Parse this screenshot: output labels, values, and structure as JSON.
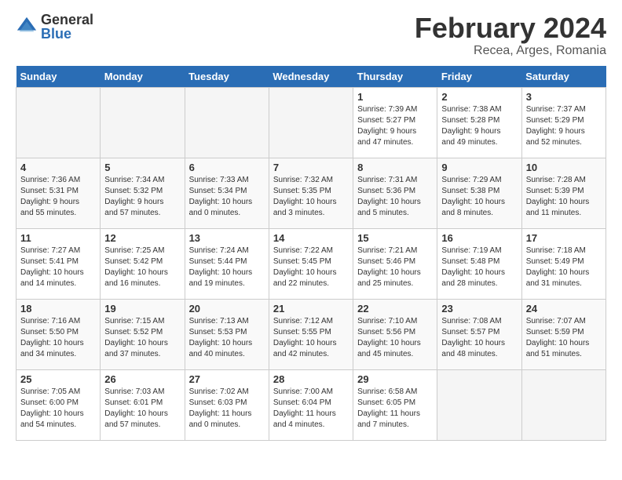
{
  "header": {
    "logo_general": "General",
    "logo_blue": "Blue",
    "month_title": "February 2024",
    "location": "Recea, Arges, Romania"
  },
  "days_of_week": [
    "Sunday",
    "Monday",
    "Tuesday",
    "Wednesday",
    "Thursday",
    "Friday",
    "Saturday"
  ],
  "weeks": [
    [
      {
        "day": "",
        "info": ""
      },
      {
        "day": "",
        "info": ""
      },
      {
        "day": "",
        "info": ""
      },
      {
        "day": "",
        "info": ""
      },
      {
        "day": "1",
        "info": "Sunrise: 7:39 AM\nSunset: 5:27 PM\nDaylight: 9 hours\nand 47 minutes."
      },
      {
        "day": "2",
        "info": "Sunrise: 7:38 AM\nSunset: 5:28 PM\nDaylight: 9 hours\nand 49 minutes."
      },
      {
        "day": "3",
        "info": "Sunrise: 7:37 AM\nSunset: 5:29 PM\nDaylight: 9 hours\nand 52 minutes."
      }
    ],
    [
      {
        "day": "4",
        "info": "Sunrise: 7:36 AM\nSunset: 5:31 PM\nDaylight: 9 hours\nand 55 minutes."
      },
      {
        "day": "5",
        "info": "Sunrise: 7:34 AM\nSunset: 5:32 PM\nDaylight: 9 hours\nand 57 minutes."
      },
      {
        "day": "6",
        "info": "Sunrise: 7:33 AM\nSunset: 5:34 PM\nDaylight: 10 hours\nand 0 minutes."
      },
      {
        "day": "7",
        "info": "Sunrise: 7:32 AM\nSunset: 5:35 PM\nDaylight: 10 hours\nand 3 minutes."
      },
      {
        "day": "8",
        "info": "Sunrise: 7:31 AM\nSunset: 5:36 PM\nDaylight: 10 hours\nand 5 minutes."
      },
      {
        "day": "9",
        "info": "Sunrise: 7:29 AM\nSunset: 5:38 PM\nDaylight: 10 hours\nand 8 minutes."
      },
      {
        "day": "10",
        "info": "Sunrise: 7:28 AM\nSunset: 5:39 PM\nDaylight: 10 hours\nand 11 minutes."
      }
    ],
    [
      {
        "day": "11",
        "info": "Sunrise: 7:27 AM\nSunset: 5:41 PM\nDaylight: 10 hours\nand 14 minutes."
      },
      {
        "day": "12",
        "info": "Sunrise: 7:25 AM\nSunset: 5:42 PM\nDaylight: 10 hours\nand 16 minutes."
      },
      {
        "day": "13",
        "info": "Sunrise: 7:24 AM\nSunset: 5:44 PM\nDaylight: 10 hours\nand 19 minutes."
      },
      {
        "day": "14",
        "info": "Sunrise: 7:22 AM\nSunset: 5:45 PM\nDaylight: 10 hours\nand 22 minutes."
      },
      {
        "day": "15",
        "info": "Sunrise: 7:21 AM\nSunset: 5:46 PM\nDaylight: 10 hours\nand 25 minutes."
      },
      {
        "day": "16",
        "info": "Sunrise: 7:19 AM\nSunset: 5:48 PM\nDaylight: 10 hours\nand 28 minutes."
      },
      {
        "day": "17",
        "info": "Sunrise: 7:18 AM\nSunset: 5:49 PM\nDaylight: 10 hours\nand 31 minutes."
      }
    ],
    [
      {
        "day": "18",
        "info": "Sunrise: 7:16 AM\nSunset: 5:50 PM\nDaylight: 10 hours\nand 34 minutes."
      },
      {
        "day": "19",
        "info": "Sunrise: 7:15 AM\nSunset: 5:52 PM\nDaylight: 10 hours\nand 37 minutes."
      },
      {
        "day": "20",
        "info": "Sunrise: 7:13 AM\nSunset: 5:53 PM\nDaylight: 10 hours\nand 40 minutes."
      },
      {
        "day": "21",
        "info": "Sunrise: 7:12 AM\nSunset: 5:55 PM\nDaylight: 10 hours\nand 42 minutes."
      },
      {
        "day": "22",
        "info": "Sunrise: 7:10 AM\nSunset: 5:56 PM\nDaylight: 10 hours\nand 45 minutes."
      },
      {
        "day": "23",
        "info": "Sunrise: 7:08 AM\nSunset: 5:57 PM\nDaylight: 10 hours\nand 48 minutes."
      },
      {
        "day": "24",
        "info": "Sunrise: 7:07 AM\nSunset: 5:59 PM\nDaylight: 10 hours\nand 51 minutes."
      }
    ],
    [
      {
        "day": "25",
        "info": "Sunrise: 7:05 AM\nSunset: 6:00 PM\nDaylight: 10 hours\nand 54 minutes."
      },
      {
        "day": "26",
        "info": "Sunrise: 7:03 AM\nSunset: 6:01 PM\nDaylight: 10 hours\nand 57 minutes."
      },
      {
        "day": "27",
        "info": "Sunrise: 7:02 AM\nSunset: 6:03 PM\nDaylight: 11 hours\nand 0 minutes."
      },
      {
        "day": "28",
        "info": "Sunrise: 7:00 AM\nSunset: 6:04 PM\nDaylight: 11 hours\nand 4 minutes."
      },
      {
        "day": "29",
        "info": "Sunrise: 6:58 AM\nSunset: 6:05 PM\nDaylight: 11 hours\nand 7 minutes."
      },
      {
        "day": "",
        "info": ""
      },
      {
        "day": "",
        "info": ""
      }
    ]
  ]
}
